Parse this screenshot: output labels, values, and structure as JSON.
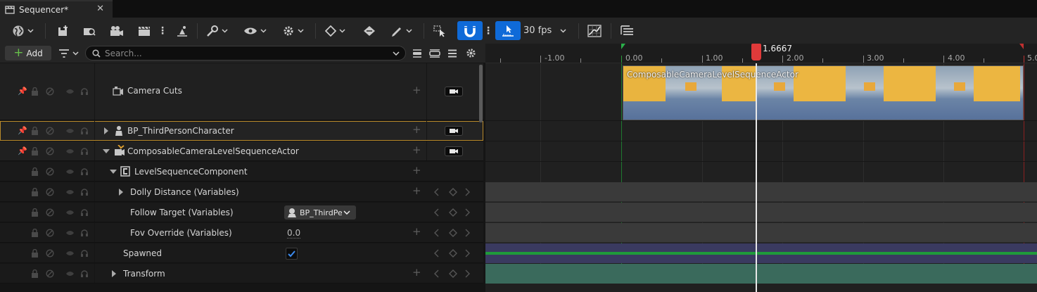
{
  "tab": {
    "title": "Sequencer*",
    "close": "✕"
  },
  "toolbar": {
    "fps_label": "30 fps"
  },
  "add_button": {
    "label": "Add",
    "plus": "+"
  },
  "search": {
    "placeholder": "Search..."
  },
  "ruler": {
    "ticks": [
      "-1.00",
      "0.00",
      "1.00",
      "2.00",
      "3.00",
      "4.00",
      "5.0"
    ],
    "playhead": "1.6667"
  },
  "rows": {
    "camera_cuts": "Camera Cuts",
    "bp_third_person": "BP_ThirdPersonCharacter",
    "composable_actor": "ComposableCameraLevelSequenceActor",
    "level_sequence_component": "LevelSequenceComponent",
    "dolly_distance": "Dolly Distance (Variables)",
    "follow_target": "Follow Target (Variables)",
    "follow_target_value": "BP_ThirdPer",
    "fov_override": "Fov Override (Variables)",
    "fov_value": "0.0",
    "spawned": "Spawned",
    "transform": "Transform"
  },
  "camera_section": {
    "label": "ComposableCameraLevelSequenceActor"
  },
  "colors": {
    "accent_blue": "#0f6ad8",
    "playhead_red": "#e03a3a",
    "selection_border": "#b98a2a",
    "spawned_track": "#3a3a60",
    "spawned_line": "#1f9a3a",
    "transform_track": "#3a6a5c"
  }
}
